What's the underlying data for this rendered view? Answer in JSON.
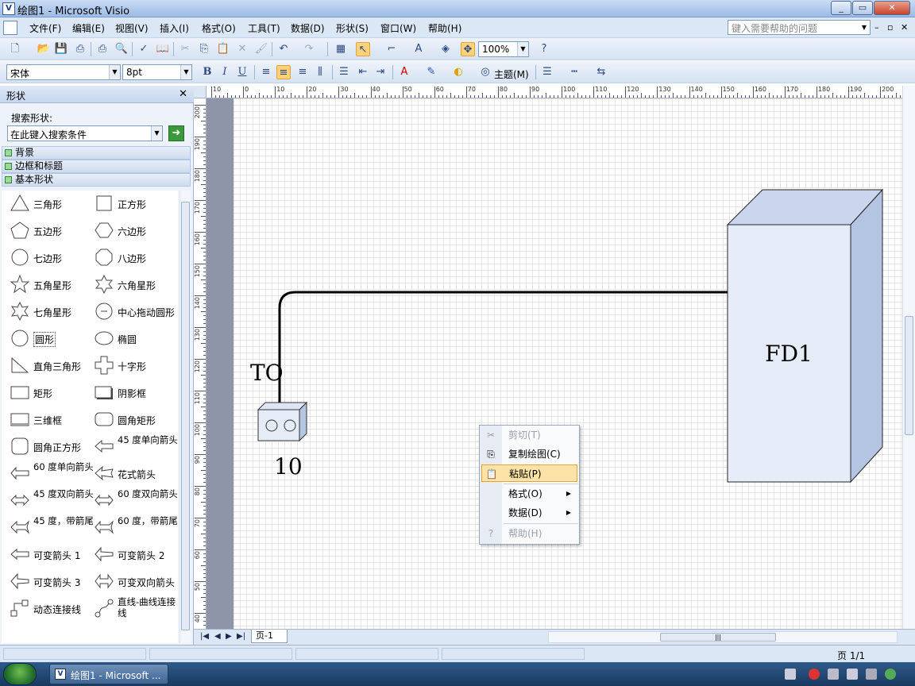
{
  "window": {
    "title": "绘图1 - Microsoft Visio",
    "app_icon": "visio-icon"
  },
  "menu": {
    "items": [
      "文件(F)",
      "编辑(E)",
      "视图(V)",
      "插入(I)",
      "格式(O)",
      "工具(T)",
      "数据(D)",
      "形状(S)",
      "窗口(W)",
      "帮助(H)"
    ],
    "help_placeholder": "键入需要帮助的问题"
  },
  "toolbar": {
    "zoom": "100%",
    "font": "宋体",
    "font_size": "8pt",
    "theme_label": "主题(M)"
  },
  "shapes_pane": {
    "title": "形状",
    "search_label": "搜索形状:",
    "search_placeholder": "在此键入搜索条件",
    "stencils": [
      "背景",
      "边框和标题",
      "基本形状"
    ],
    "shapes": [
      {
        "label": "三角形",
        "icon": "triangle-icon"
      },
      {
        "label": "正方形",
        "icon": "square-icon"
      },
      {
        "label": "五边形",
        "icon": "pentagon-icon"
      },
      {
        "label": "六边形",
        "icon": "hexagon-icon"
      },
      {
        "label": "七边形",
        "icon": "heptagon-icon"
      },
      {
        "label": "八边形",
        "icon": "octagon-icon"
      },
      {
        "label": "五角星形",
        "icon": "star5-icon"
      },
      {
        "label": "六角星形",
        "icon": "star6-icon"
      },
      {
        "label": "七角星形",
        "icon": "star7-icon"
      },
      {
        "label": "中心拖动圆形",
        "icon": "center-circle-icon"
      },
      {
        "label": "圆形",
        "icon": "circle-icon"
      },
      {
        "label": "椭圆",
        "icon": "ellipse-icon"
      },
      {
        "label": "直角三角形",
        "icon": "right-triangle-icon"
      },
      {
        "label": "十字形",
        "icon": "cross-icon"
      },
      {
        "label": "矩形",
        "icon": "rectangle-icon"
      },
      {
        "label": "阴影框",
        "icon": "shadow-box-icon"
      },
      {
        "label": "三维框",
        "icon": "3d-box-icon"
      },
      {
        "label": "圆角矩形",
        "icon": "rounded-rect-icon"
      },
      {
        "label": "圆角正方形",
        "icon": "rounded-square-icon"
      },
      {
        "label": "45 度单向箭头",
        "icon": "arrow-45-icon"
      },
      {
        "label": "60 度单向箭头",
        "icon": "arrow-60-icon"
      },
      {
        "label": "花式箭头",
        "icon": "fancy-arrow-icon"
      },
      {
        "label": "45 度双向箭头",
        "icon": "double-arrow-45-icon"
      },
      {
        "label": "60 度双向箭头",
        "icon": "double-arrow-60-icon"
      },
      {
        "label": "45 度，带箭尾",
        "icon": "tail-arrow-45-icon"
      },
      {
        "label": "60 度，带箭尾",
        "icon": "tail-arrow-60-icon"
      },
      {
        "label": "可变箭头 1",
        "icon": "flex-arrow-1-icon"
      },
      {
        "label": "可变箭头 2",
        "icon": "flex-arrow-2-icon"
      },
      {
        "label": "可变箭头 3",
        "icon": "flex-arrow-3-icon"
      },
      {
        "label": "可变双向箭头",
        "icon": "flex-double-arrow-icon"
      },
      {
        "label": "动态连接线",
        "icon": "dynamic-connector-icon"
      },
      {
        "label": "直线-曲线连接线",
        "icon": "line-curve-connector-icon"
      }
    ]
  },
  "rulers": {
    "horizontal": [
      "10",
      "0",
      "10",
      "20",
      "30",
      "40",
      "50",
      "60",
      "70",
      "80",
      "90",
      "100",
      "110",
      "120",
      "130",
      "140",
      "150",
      "160",
      "170",
      "180",
      "190",
      "200"
    ],
    "vertical": [
      "200",
      "190",
      "180",
      "170",
      "160",
      "150",
      "140",
      "130",
      "120",
      "110",
      "100",
      "90",
      "80",
      "70",
      "60",
      "50",
      "40"
    ]
  },
  "drawing": {
    "to_label": "TO",
    "outlet_number": "10",
    "cabinet_label": "FD1"
  },
  "context_menu": {
    "items": [
      {
        "label": "剪切(T)",
        "disabled": true,
        "icon": "scissors-icon"
      },
      {
        "label": "复制绘图(C)",
        "disabled": false,
        "icon": "copy-icon"
      },
      {
        "label": "粘贴(P)",
        "disabled": false,
        "highlighted": true,
        "icon": "paste-icon"
      },
      {
        "label": "格式(O)",
        "disabled": false,
        "submenu": true
      },
      {
        "label": "数据(D)",
        "disabled": false,
        "submenu": true
      },
      {
        "label": "帮助(H)",
        "disabled": true,
        "icon": "help-icon"
      }
    ]
  },
  "pagebar": {
    "page_tab": "页-1"
  },
  "statusbar": {
    "page_indicator": "页 1/1"
  },
  "taskbar": {
    "task_label": "绘图1 - Microsoft ..."
  }
}
